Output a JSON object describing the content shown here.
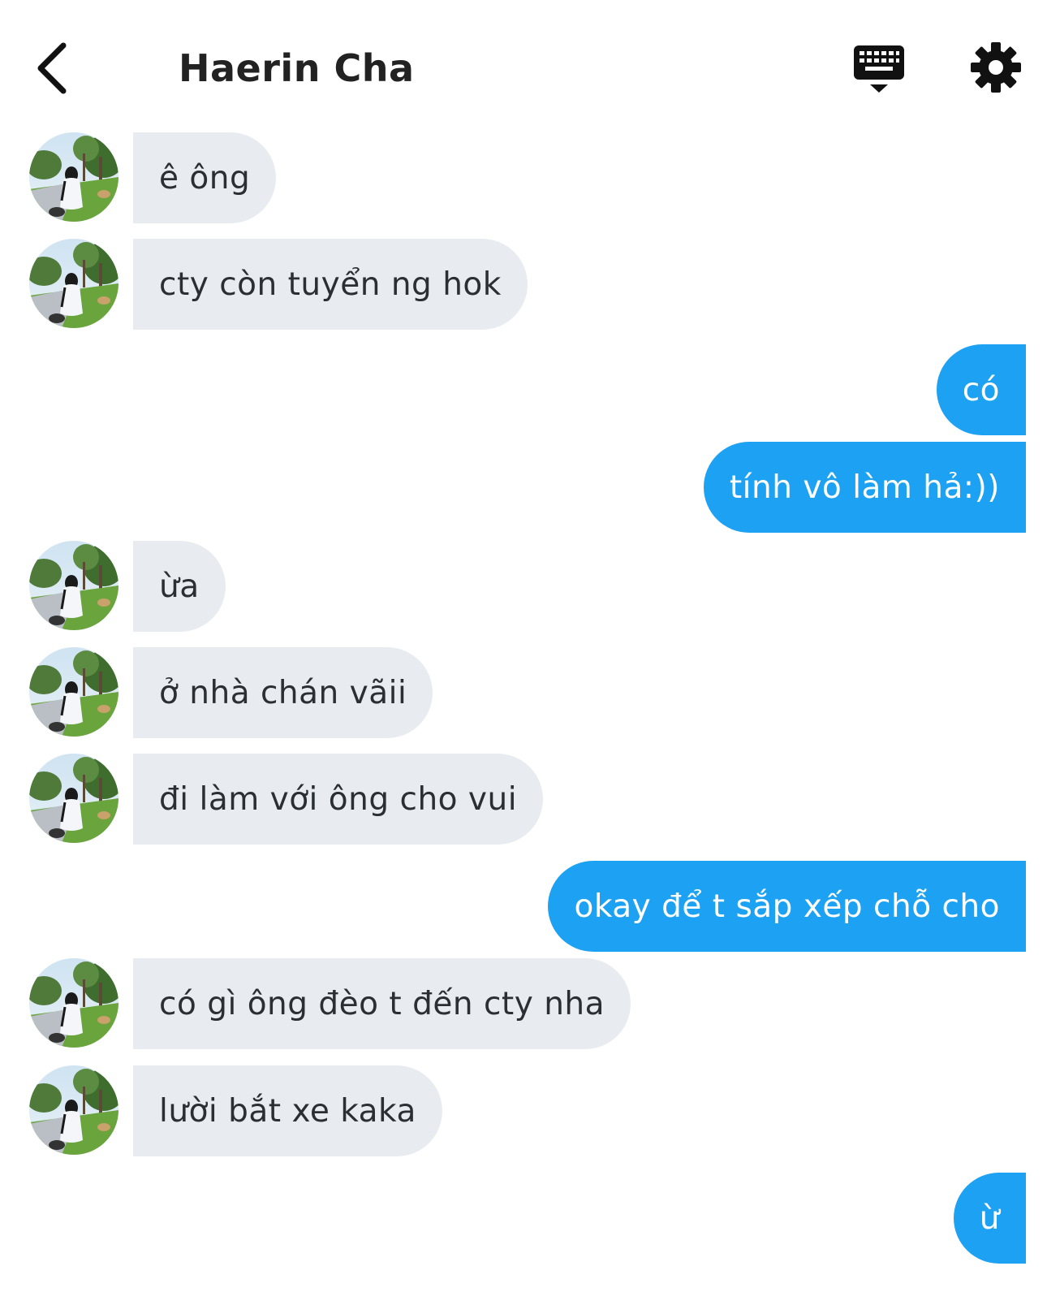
{
  "header": {
    "title": "Haerin Cha",
    "back_icon": "chevron-left-icon",
    "keyboard_icon": "keyboard-icon",
    "settings_icon": "gear-icon"
  },
  "colors": {
    "incoming_bubble": "#e8ecf0",
    "outgoing_bubble": "#1da1f2",
    "incoming_text": "#2b2f33",
    "outgoing_text": "#ffffff"
  },
  "messages": [
    {
      "direction": "in",
      "text": "ê ông"
    },
    {
      "direction": "in",
      "text": "cty còn tuyển ng hok"
    },
    {
      "direction": "out",
      "text": "có"
    },
    {
      "direction": "out",
      "text": "tính vô làm hả:))"
    },
    {
      "direction": "in",
      "text": "ừa"
    },
    {
      "direction": "in",
      "text": "ở nhà chán vãii"
    },
    {
      "direction": "in",
      "text": "đi làm với ông cho vui"
    },
    {
      "direction": "out",
      "text": "okay để t sắp xếp chỗ cho"
    },
    {
      "direction": "in",
      "text": "có gì ông đèo t đến cty nha"
    },
    {
      "direction": "in",
      "text": "lười bắt xe kaka"
    },
    {
      "direction": "out",
      "text": "ừ"
    }
  ]
}
